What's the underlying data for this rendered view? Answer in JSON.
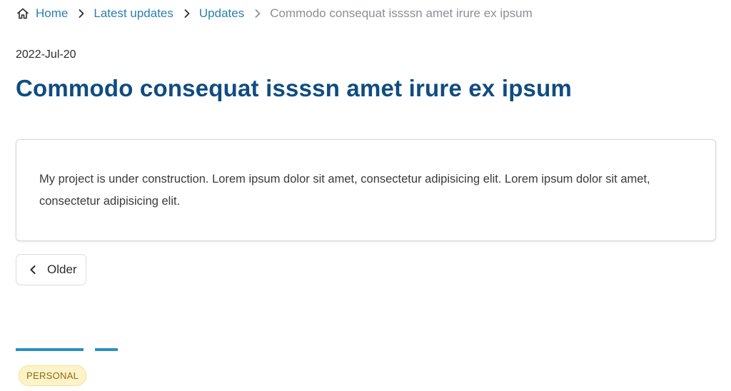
{
  "breadcrumb": {
    "home_label": "Home",
    "items": [
      {
        "label": "Latest updates"
      },
      {
        "label": "Updates"
      }
    ],
    "current": "Commodo consequat issssn amet irure ex ipsum"
  },
  "article": {
    "date": "2022-Jul-20",
    "title": "Commodo consequat issssn amet irure ex ipsum",
    "body": "My project is under construction. Lorem ipsum dolor sit amet, consectetur adipisicing elit. Lorem ipsum dolor sit amet, consectetur adipisicing elit."
  },
  "navigation": {
    "older_label": "Older"
  },
  "tags": [
    {
      "label": "PERSONAL"
    }
  ],
  "icons": {
    "home": "home-icon",
    "separator": "chevron-right-icon",
    "older": "chevron-left-icon"
  },
  "colors": {
    "link": "#2a7fb0",
    "title": "#0f4c81",
    "accent_line": "#2a8fc0",
    "tag_bg": "#fdf3c9",
    "tag_text": "#8a6a10"
  }
}
